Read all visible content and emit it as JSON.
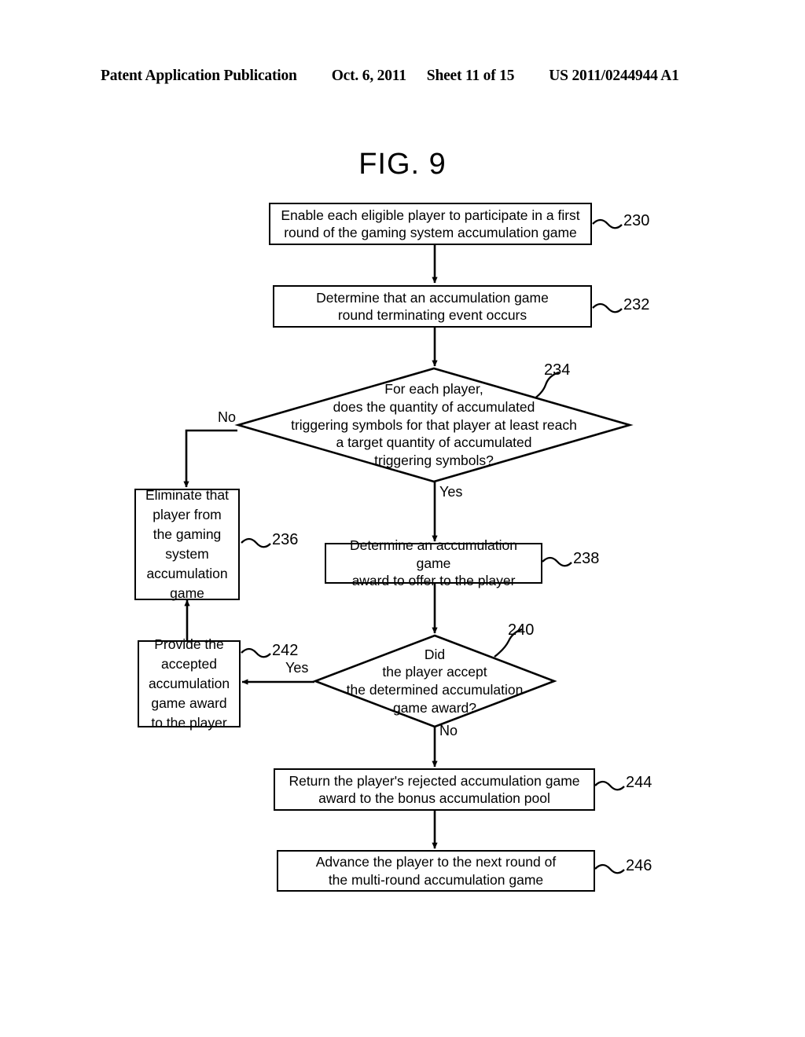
{
  "header": {
    "publication": "Patent Application Publication",
    "date": "Oct. 6, 2011",
    "sheet": "Sheet 11 of 15",
    "number": "US 2011/0244944 A1"
  },
  "figure": {
    "title": "FIG. 9"
  },
  "nodes": {
    "n230": {
      "ref": "230",
      "type": "process",
      "line1": "Enable each eligible player to participate in a first",
      "line2": "round of the gaming system accumulation game"
    },
    "n232": {
      "ref": "232",
      "type": "process",
      "line1": "Determine that an accumulation game",
      "line2": "round terminating event occurs"
    },
    "n234": {
      "ref": "234",
      "type": "decision",
      "line1": "For each player,",
      "line2": "does the quantity of accumulated",
      "line3": "triggering symbols for that player at least reach",
      "line4": "a target quantity of accumulated",
      "line5": "triggering symbols?"
    },
    "n236": {
      "ref": "236",
      "type": "process",
      "line1": "Eliminate that",
      "line2": "player from",
      "line3": "the gaming",
      "line4": "system",
      "line5": "accumulation",
      "line6": "game"
    },
    "n238": {
      "ref": "238",
      "type": "process",
      "line1": "Determine an accumulation game",
      "line2": "award to offer to the player"
    },
    "n240": {
      "ref": "240",
      "type": "decision",
      "line1": "Did",
      "line2": "the player accept",
      "line3": "the determined accumulation",
      "line4": "game award?"
    },
    "n242": {
      "ref": "242",
      "type": "process",
      "line1": "Provide the",
      "line2": "accepted",
      "line3": "accumulation",
      "line4": "game award",
      "line5": "to the player"
    },
    "n244": {
      "ref": "244",
      "type": "process",
      "line1": "Return the player's rejected accumulation game",
      "line2": "award to the bonus accumulation pool"
    },
    "n246": {
      "ref": "246",
      "type": "process",
      "line1": "Advance the player to the next round of",
      "line2": "the multi-round accumulation game"
    }
  },
  "branch_labels": {
    "d234_no": "No",
    "d234_yes": "Yes",
    "d240_yes": "Yes",
    "d240_no": "No"
  },
  "colors": {
    "ink": "#000000",
    "paper": "#ffffff"
  }
}
